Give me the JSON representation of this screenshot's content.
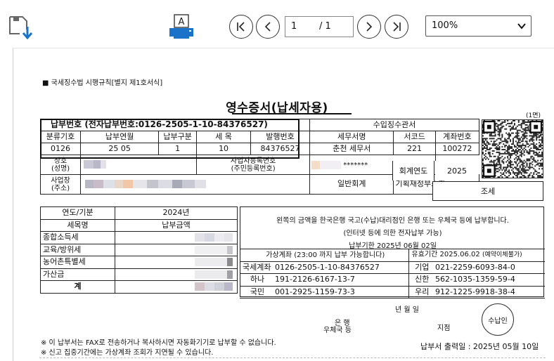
{
  "toolbar": {
    "page_current": "1",
    "page_total": "/ 1",
    "zoom": "100%",
    "print_icon_letter": "A"
  },
  "document": {
    "form_label": "■ 국세징수법 시행규칙[별지 제1호서식]",
    "title": "영수증서(납세자용)",
    "page_mark": "(1면)",
    "payment_no_label": "납부번호 (전자납부번호:0126-2505-1-10-84376527)",
    "collector_label": "수입징수관서",
    "headers": [
      "분류기호",
      "납부연월",
      "납부구분",
      "세 목",
      "발행번호",
      "세무서명",
      "서코드",
      "계좌번호"
    ],
    "values": [
      "0126",
      "25 05",
      "1",
      "10",
      "84376527",
      "춘천 세무서",
      "221",
      "100272"
    ],
    "name_label": "상호\n(성명)",
    "bizno_label": "사업자등록번호\n(주민등록번호)",
    "masked_id": "*******",
    "fiscal_year_label": "회계연도",
    "fiscal_year": "2025",
    "address_label": "사업장\n(주소)",
    "account_type": "일반회계",
    "ministry": "기획재정부소관",
    "tax_kind": "조세",
    "year_period_label": "연도/기분",
    "year_period": "2024년",
    "tax_item_label": "세목명",
    "amount_label": "납부금액",
    "tax_items": [
      "종합소득세",
      "교육/방위세",
      "농어촌특별세",
      "가산금",
      "계"
    ],
    "notice_line1": "왼쪽의 금액을 한국은행 국고(수납)대리점인 은행 또는 우체국 등에 납부합니다.",
    "notice_line2": "(인터넷 등에 의한 전자납부 가능)",
    "due_date": "납부기한  2025년 06월 02일",
    "virtual_acct_label": "가상계좌 (23:00 까지 납부 가능합니다)",
    "valid_label": "유효기간  2025.06.02",
    "valid_note": "(예약이체불가)",
    "accounts": [
      {
        "bank": "국세계좌",
        "no": "0126-2505-1-10-84376527",
        "bank2": "기업",
        "no2": "021-2259-6093-84-0"
      },
      {
        "bank": "하나",
        "no": "191-2126-6167-13-7",
        "bank2": "신한",
        "no2": "562-1035-1359-59-4"
      },
      {
        "bank": "국민",
        "no": "001-2925-1159-73-3",
        "bank2": "우리",
        "no2": "912-1225-9918-38-4"
      }
    ],
    "date_label": "년   월   일",
    "bank_label": "은     행",
    "post_label": "우체국 등",
    "branch_label": "지점",
    "stamp": "수납인",
    "footnote1": "※ 이 납부서는 FAX로 전송하거나 복사하시면 자동화기기로 납부할 수 없습니다.",
    "footnote2": "※ 신고 집중기간에는 가상계좌 조회가 지연될 수 있습니다.",
    "printed_date": "납부서 출력일 : 2025년 05월 10일"
  },
  "colors": {
    "save_icon_arrow": "#1a73c8",
    "print_icon": "#1a73c8"
  }
}
